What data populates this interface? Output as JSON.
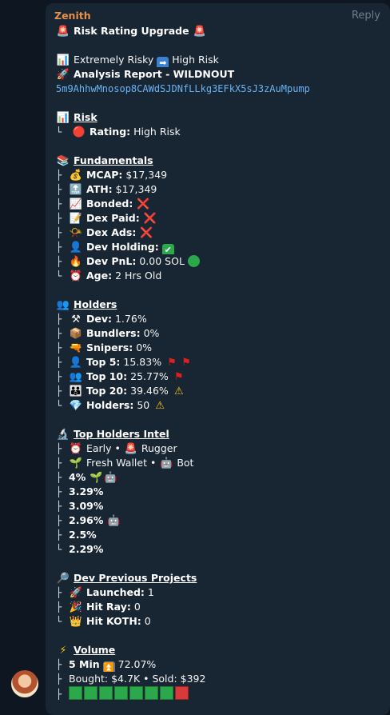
{
  "message": {
    "sender": "Zenith",
    "reply_label": "Reply",
    "header": "Risk Rating Upgrade",
    "rating_change_from": "Extremely Risky",
    "rating_change_to": "High Risk",
    "report_title": "Analysis Report - WILDNOUT",
    "contract_address": "5m9AhhwMnosop8CAWdSJDNfLLkg3EFkX5sJ3zAuMpump",
    "risk": {
      "title": "Risk",
      "rating_label": "Rating:",
      "rating_value": "High Risk"
    },
    "fundamentals": {
      "title": "Fundamentals",
      "items": [
        {
          "label": "MCAP:",
          "value": "$17,349",
          "icon": "money-bag-icon"
        },
        {
          "label": "ATH:",
          "value": "$17,349",
          "icon": "top-arrow-icon"
        },
        {
          "label": "Bonded:",
          "value": "",
          "icon": "chart-icon",
          "status": "cross"
        },
        {
          "label": "Dex Paid:",
          "value": "",
          "icon": "memo-icon",
          "status": "cross"
        },
        {
          "label": "Dex Ads:",
          "value": "",
          "icon": "megaphone-icon",
          "status": "cross"
        },
        {
          "label": "Dev Holding:",
          "value": "",
          "icon": "user-icon",
          "status": "check"
        },
        {
          "label": "Dev PnL:",
          "value": "0.00 SOL",
          "icon": "fire-icon",
          "status": "green-circle"
        },
        {
          "label": "Age:",
          "value": "2 Hrs Old",
          "icon": "alarm-clock-icon"
        }
      ]
    },
    "holders": {
      "title": "Holders",
      "items": [
        {
          "label": "Dev:",
          "value": "1.76%",
          "icon": "pick-icon"
        },
        {
          "label": "Bundlers:",
          "value": "0%",
          "icon": "package-icon"
        },
        {
          "label": "Snipers:",
          "value": "0%",
          "icon": "gun-icon"
        },
        {
          "label": "Top 5:",
          "value": "15.83%",
          "icon": "user-icon",
          "flags": 2
        },
        {
          "label": "Top 10:",
          "value": "25.77%",
          "icon": "users-icon",
          "flags": 1
        },
        {
          "label": "Top 20:",
          "value": "39.46%",
          "icon": "family-icon",
          "warning": true
        },
        {
          "label": "Holders:",
          "value": "50",
          "icon": "gem-icon",
          "warning": true
        }
      ]
    },
    "top_holders": {
      "title": "Top Holders Intel",
      "legend_early": "Early",
      "legend_rugger": "Rugger",
      "legend_fresh": "Fresh Wallet",
      "legend_bot": "Bot",
      "values": [
        {
          "value": "4%",
          "tags": [
            "fresh",
            "bot"
          ]
        },
        {
          "value": "3.29%",
          "tags": []
        },
        {
          "value": "3.09%",
          "tags": []
        },
        {
          "value": "2.96%",
          "tags": [
            "bot"
          ]
        },
        {
          "value": "2.5%",
          "tags": []
        },
        {
          "value": "2.29%",
          "tags": []
        }
      ]
    },
    "dev_projects": {
      "title": "Dev Previous Projects",
      "items": [
        {
          "label": "Launched:",
          "value": "1",
          "icon": "rocket-icon"
        },
        {
          "label": "Hit Ray:",
          "value": "0",
          "icon": "party-icon"
        },
        {
          "label": "Hit KOTH:",
          "value": "0",
          "icon": "crown-icon"
        }
      ]
    },
    "volume": {
      "title": "Volume",
      "period_label": "5 Min",
      "period_change": "72.07%",
      "bought_label": "Bought:",
      "bought_value": "$4.7K",
      "sold_label": "Sold:",
      "sold_value": "$392",
      "bar_green_count": 7,
      "bar_red_count": 1
    }
  },
  "colors": {
    "background": "#0e1621",
    "bubble": "#182533",
    "sender": "#e98f48",
    "link": "#6ab3f3"
  }
}
